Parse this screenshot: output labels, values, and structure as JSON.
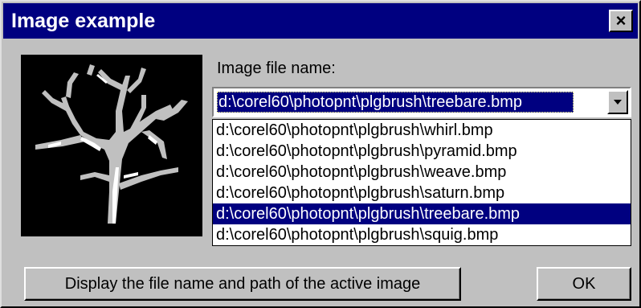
{
  "window": {
    "title": "Image example",
    "close_label": "×"
  },
  "form": {
    "label": "Image file name:",
    "selected_value": "d:\\corel60\\photopnt\\plgbrush\\treebare.bmp",
    "options": [
      "d:\\corel60\\photopnt\\plgbrush\\whirl.bmp",
      "d:\\corel60\\photopnt\\plgbrush\\pyramid.bmp",
      "d:\\corel60\\photopnt\\plgbrush\\weave.bmp",
      "d:\\corel60\\photopnt\\plgbrush\\saturn.bmp",
      "d:\\corel60\\photopnt\\plgbrush\\treebare.bmp",
      "d:\\corel60\\photopnt\\plgbrush\\squig.bmp"
    ],
    "selected_index": 4
  },
  "buttons": {
    "display": "Display the file name and path of the active image",
    "ok": "OK"
  },
  "icons": {
    "preview": "tree-image",
    "close": "close-icon",
    "dropdown": "dropdown-arrow-icon"
  },
  "colors": {
    "titlebar": "#000080",
    "selection": "#000080",
    "face": "#c0c0c0"
  }
}
